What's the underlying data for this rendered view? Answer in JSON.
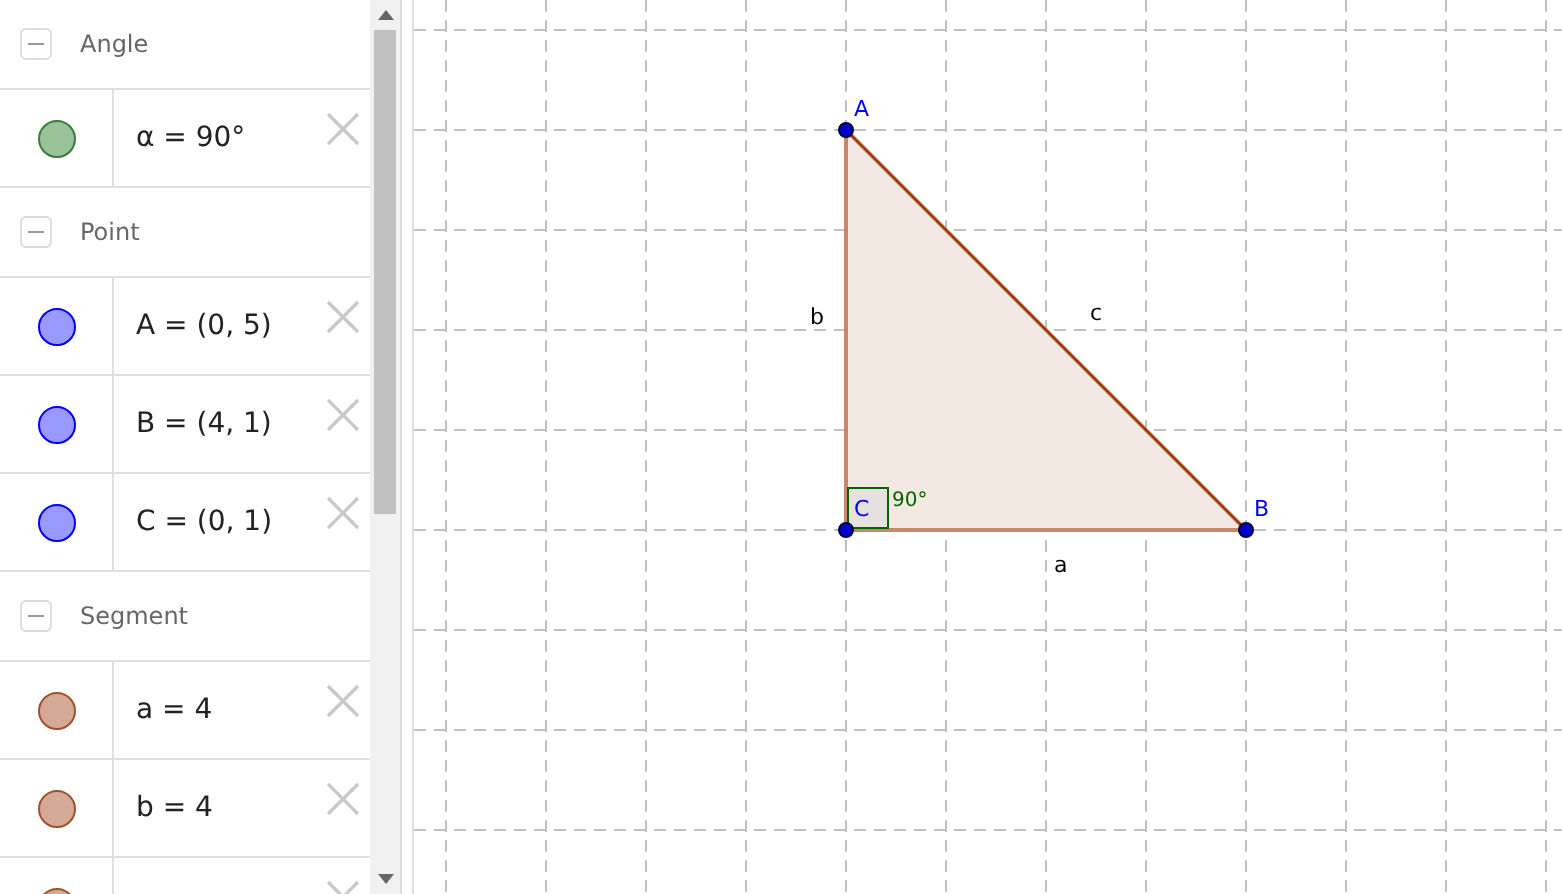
{
  "algebra_view": {
    "groups": [
      {
        "title": "Angle",
        "expanded": true,
        "items": [
          {
            "value": "α = 90°",
            "color": "#99c299"
          }
        ]
      },
      {
        "title": "Point",
        "expanded": true,
        "items": [
          {
            "value": "A = (0, 5)",
            "color": "#9999ff"
          },
          {
            "value": "B = (4, 1)",
            "color": "#9999ff"
          },
          {
            "value": "C = (0, 1)",
            "color": "#9999ff"
          }
        ]
      },
      {
        "title": "Segment",
        "expanded": true,
        "items": [
          {
            "value": "a = 4",
            "color": "#d4a995"
          },
          {
            "value": "b = 4",
            "color": "#d4a995"
          },
          {
            "color": "#d4a995"
          }
        ]
      }
    ]
  },
  "graphics": {
    "point_labels": [
      "A",
      "B",
      "C"
    ],
    "segment_labels": [
      "a",
      "b",
      "c"
    ],
    "angle_label": "90°"
  }
}
